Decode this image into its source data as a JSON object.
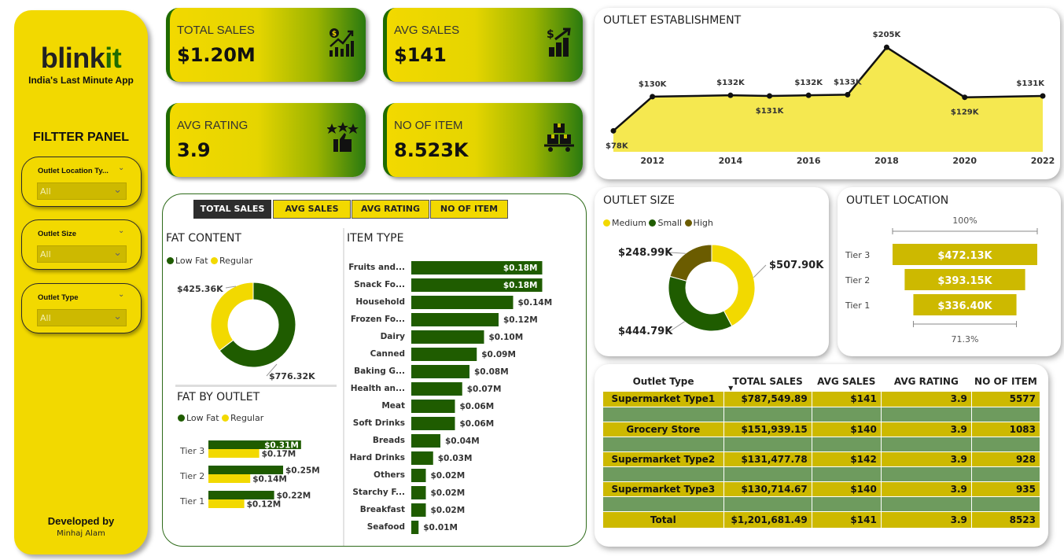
{
  "sidebar": {
    "logo_main": "blink",
    "logo_accent": "it",
    "tagline": "India's Last Minute App",
    "panel_title": "FILTTER PANEL",
    "slicers": [
      {
        "label": "Outlet Location Ty...",
        "value": "All"
      },
      {
        "label": "Outlet Size",
        "value": "All"
      },
      {
        "label": "Outlet Type",
        "value": "All"
      }
    ],
    "developed_by": "Developed by",
    "developer": "Minhaj Alam"
  },
  "kpis": [
    {
      "title": "TOTAL SALES",
      "value": "$1.20M",
      "icon": "sales-chart-icon"
    },
    {
      "title": "AVG SALES",
      "value": "$141",
      "icon": "dollar-bars-icon"
    },
    {
      "title": "AVG RATING",
      "value": "3.9",
      "icon": "thumbs-up-stars-icon"
    },
    {
      "title": "NO OF ITEM",
      "value": "8.523K",
      "icon": "boxes-cart-icon"
    }
  ],
  "tabs": [
    "TOTAL SALES",
    "AVG SALES",
    "AVG RATING",
    "NO OF ITEM"
  ],
  "colors": {
    "yellow": "#f2d900",
    "green": "#1f5c00",
    "olive": "#cdb900",
    "dark_olive": "#6b5c00"
  },
  "chart_data": [
    {
      "id": "outlet_establishment",
      "type": "area",
      "title": "OUTLET ESTABLISHMENT",
      "x": [
        2011,
        2012,
        2014,
        2015,
        2016,
        2017,
        2018,
        2020,
        2022
      ],
      "values": [
        78,
        130,
        132,
        131,
        132,
        133,
        205,
        129,
        131
      ],
      "labels": [
        "$78K",
        "$130K",
        "$132K",
        "$131K",
        "$132K",
        "$133K",
        "$205K",
        "$129K",
        "$131K"
      ],
      "x_ticks": [
        "2012",
        "2014",
        "2016",
        "2018",
        "2020",
        "2022"
      ],
      "unit": "K"
    },
    {
      "id": "outlet_size",
      "type": "pie",
      "title": "OUTLET SIZE",
      "legend": [
        "Medium",
        "Small",
        "High"
      ],
      "values": [
        507.9,
        444.79,
        248.99
      ],
      "labels": [
        "$507.90K",
        "$444.79K",
        "$248.99K"
      ],
      "colors": [
        "#f2d900",
        "#1f5c00",
        "#6b5c00"
      ]
    },
    {
      "id": "outlet_location",
      "type": "bar",
      "title": "OUTLET LOCATION",
      "categories": [
        "Tier 3",
        "Tier 2",
        "Tier 1"
      ],
      "values": [
        472.13,
        393.15,
        336.4
      ],
      "labels": [
        "$472.13K",
        "$393.15K",
        "$336.40K"
      ],
      "top_label": "100%",
      "bottom_label": "71.3%"
    },
    {
      "id": "fat_content",
      "type": "pie",
      "title": "FAT CONTENT",
      "legend": [
        "Low Fat",
        "Regular"
      ],
      "values": [
        776.32,
        425.36
      ],
      "labels": [
        "$776.32K",
        "$425.36K"
      ],
      "colors": [
        "#1f5c00",
        "#f2d900"
      ]
    },
    {
      "id": "fat_by_outlet",
      "type": "bar",
      "title": "FAT BY OUTLET",
      "categories": [
        "Tier 3",
        "Tier 2",
        "Tier 1"
      ],
      "series": [
        {
          "name": "Low Fat",
          "values": [
            0.31,
            0.25,
            0.22
          ],
          "labels": [
            "$0.31M",
            "$0.25M",
            "$0.22M"
          ]
        },
        {
          "name": "Regular",
          "values": [
            0.17,
            0.14,
            0.12
          ],
          "labels": [
            "$0.17M",
            "$0.14M",
            "$0.12M"
          ]
        }
      ]
    },
    {
      "id": "item_type",
      "type": "bar",
      "title": "ITEM TYPE",
      "categories": [
        "Fruits and...",
        "Snack Fo...",
        "Household",
        "Frozen Fo...",
        "Dairy",
        "Canned",
        "Baking G...",
        "Health an...",
        "Meat",
        "Soft Drinks",
        "Breads",
        "Hard Drinks",
        "Others",
        "Starchy F...",
        "Breakfast",
        "Seafood"
      ],
      "values": [
        0.18,
        0.18,
        0.14,
        0.12,
        0.1,
        0.09,
        0.08,
        0.07,
        0.06,
        0.06,
        0.04,
        0.03,
        0.02,
        0.02,
        0.02,
        0.01
      ],
      "labels": [
        "$0.18M",
        "$0.18M",
        "$0.14M",
        "$0.12M",
        "$0.10M",
        "$0.09M",
        "$0.08M",
        "$0.07M",
        "$0.06M",
        "$0.06M",
        "$0.04M",
        "$0.03M",
        "$0.02M",
        "$0.02M",
        "$0.02M",
        "$0.01M"
      ]
    },
    {
      "id": "outlet_type_table",
      "type": "table",
      "columns": [
        "Outlet Type",
        "TOTAL SALES",
        "AVG SALES",
        "AVG RATING",
        "NO OF ITEM"
      ],
      "rows": [
        [
          "Supermarket Type1",
          "$787,549.89",
          "$141",
          "3.9",
          "5577"
        ],
        [
          "Grocery Store",
          "$151,939.15",
          "$140",
          "3.9",
          "1083"
        ],
        [
          "Supermarket Type2",
          "$131,477.78",
          "$142",
          "3.9",
          "928"
        ],
        [
          "Supermarket Type3",
          "$130,714.67",
          "$140",
          "3.9",
          "935"
        ]
      ],
      "total": [
        "Total",
        "$1,201,681.49",
        "$141",
        "3.9",
        "8523"
      ]
    }
  ]
}
